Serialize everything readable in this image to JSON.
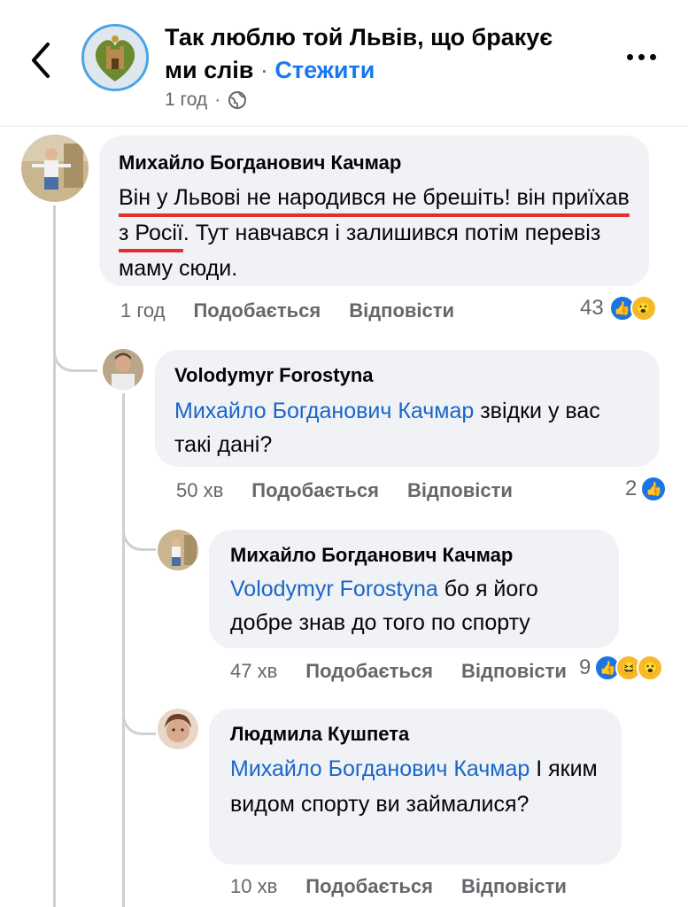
{
  "header": {
    "title": "Так люблю той Львів, що бракує ми слів",
    "separator": " · ",
    "follow": "Стежити",
    "time": "1 год",
    "dot": "·"
  },
  "comments": [
    {
      "author": "Михайло Богданович Качмар",
      "text_part1": "Він у Львові не народився не брешіть! він приїхав з Росії",
      "text_part2": ". Тут навчався і залишився потім перевіз маму сюди.",
      "time": "1 год",
      "like_label": "Подобається",
      "reply_label": "Відповісти",
      "reaction_count": "43",
      "reactions": [
        "like-icon",
        "wow-icon"
      ]
    },
    {
      "author": "Volodymyr Forostyna",
      "mention": "Михайло Богданович Качмар",
      "text": " звідки у вас такі дані?",
      "time": "50 хв",
      "like_label": "Подобається",
      "reply_label": "Відповісти",
      "reaction_count": "2",
      "reactions": [
        "like-icon"
      ]
    },
    {
      "author": "Михайло Богданович Качмар",
      "mention": "Volodymyr Forostyna",
      "text": " бо я його добре знав до того по спорту",
      "time": "47 хв",
      "like_label": "Подобається",
      "reply_label": "Відповісти",
      "reaction_count": "9",
      "reactions": [
        "like-icon",
        "haha-icon",
        "wow-icon"
      ]
    },
    {
      "author": "Людмила Кушпета",
      "mention": "Михайло Богданович Качмар",
      "text": " І яким видом спорту ви займалися?",
      "time": "10 хв",
      "like_label": "Подобається",
      "reply_label": "Відповісти"
    }
  ],
  "colors": {
    "link": "#1a66c8",
    "follow": "#1877f2",
    "bubble": "#f0f2f5",
    "underline": "#e52e2e",
    "like": "#1b74e4",
    "wow": "#f7b928"
  }
}
